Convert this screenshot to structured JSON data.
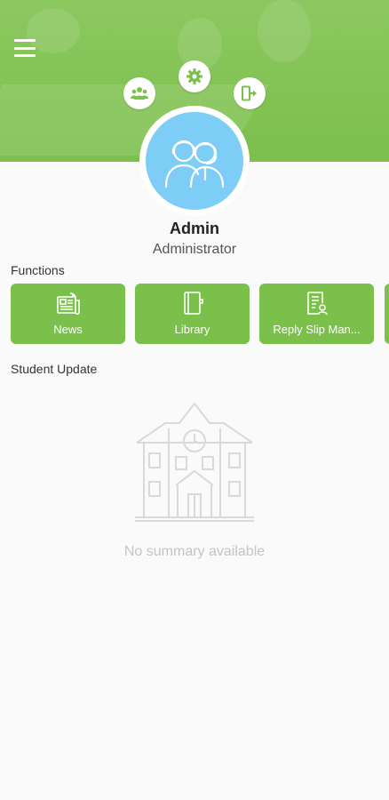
{
  "user": {
    "name": "Admin",
    "role": "Administrator"
  },
  "sections": {
    "functions": "Functions",
    "student_update": "Student Update"
  },
  "functions": [
    {
      "label": "News",
      "icon": "newspaper-icon"
    },
    {
      "label": "Library",
      "icon": "book-icon"
    },
    {
      "label": "Reply Slip Man...",
      "icon": "reply-slip-icon"
    }
  ],
  "header_actions": [
    {
      "icon": "users-icon"
    },
    {
      "icon": "gear-icon"
    },
    {
      "icon": "logout-icon"
    }
  ],
  "empty_state": {
    "message": "No summary available",
    "icon": "school-building-icon"
  },
  "colors": {
    "primary": "#7cc04c",
    "avatar_bg": "#7dcdf7",
    "empty_text": "#c4c4c4"
  }
}
